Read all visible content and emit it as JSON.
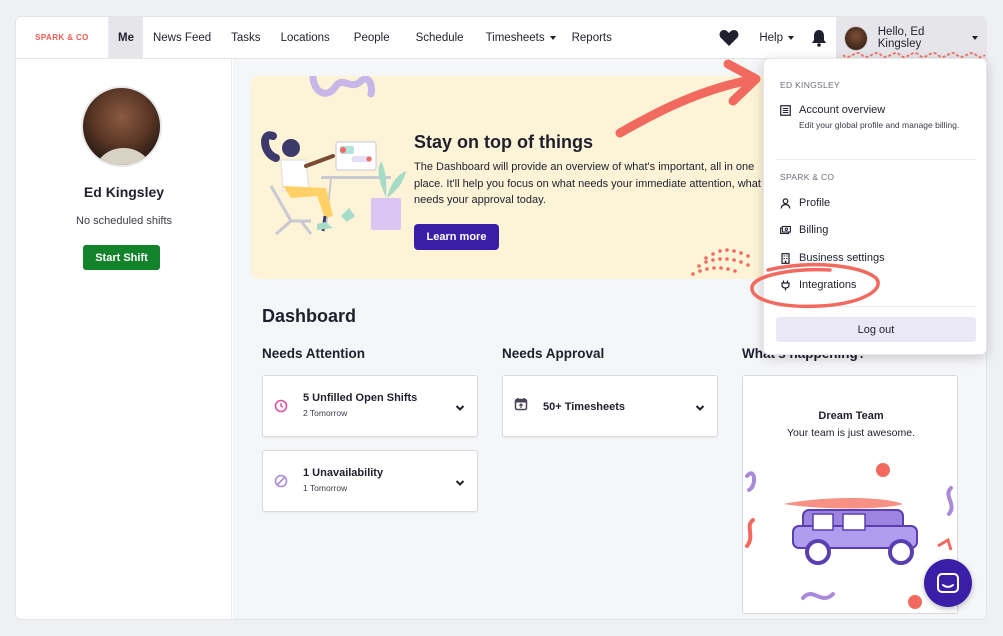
{
  "brand": {
    "logo": "SPARK & CO"
  },
  "nav": {
    "items": [
      "Me",
      "News Feed",
      "Tasks",
      "Locations",
      "People",
      "Schedule",
      "Timesheets",
      "Reports"
    ],
    "help": "Help",
    "greeting": "Hello, Ed Kingsley"
  },
  "profile": {
    "name": "Ed Kingsley",
    "shifts": "No scheduled shifts",
    "start_shift": "Start Shift"
  },
  "banner": {
    "title": "Stay on top of things",
    "text": "The Dashboard will provide an overview of what's important, all in one place. It'll help you focus on what needs your immediate attention, what needs your approval today.",
    "button": "Learn more"
  },
  "dashboard": {
    "title": "Dashboard",
    "needs_attention": {
      "title": "Needs Attention",
      "cards": [
        {
          "title": "5 Unfilled Open Shifts",
          "sub": "2 Tomorrow"
        },
        {
          "title": "1 Unavailability",
          "sub": "1 Tomorrow"
        }
      ]
    },
    "needs_approval": {
      "title": "Needs Approval",
      "cards": [
        {
          "title": "50+ Timesheets"
        }
      ]
    },
    "whats_happening": {
      "title": "What's happening?",
      "card_title": "Dream Team",
      "card_sub": "Your team is just awesome."
    }
  },
  "dropdown": {
    "user_section": "ED KINGSLEY",
    "account_overview": "Account overview",
    "account_desc": "Edit your global profile and manage billing.",
    "org_section": "SPARK & CO",
    "profile": "Profile",
    "billing": "Billing",
    "business_settings": "Business settings",
    "integrations": "Integrations",
    "logout": "Log out"
  },
  "colors": {
    "accent": "#3b1ea8",
    "start_shift": "#12822b",
    "annotation": "#f26a5f",
    "brand": "#ef5b50"
  }
}
